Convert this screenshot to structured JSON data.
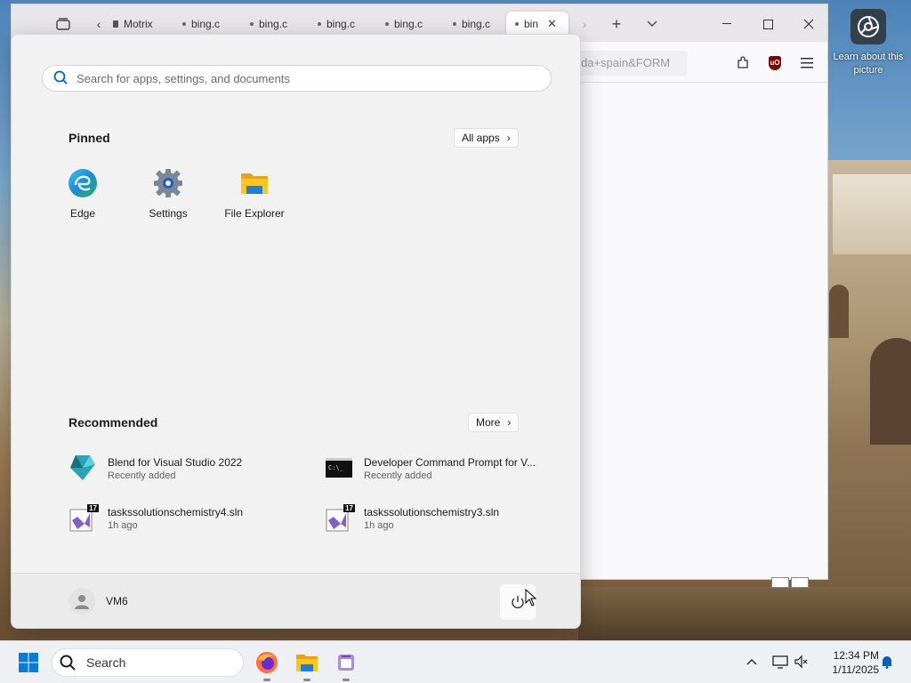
{
  "spotlight": {
    "label": "Learn about this picture"
  },
  "browser": {
    "tabs": [
      {
        "title": "Motrix"
      },
      {
        "title": "bing.c"
      },
      {
        "title": "bing.c"
      },
      {
        "title": "bing.c"
      },
      {
        "title": "bing.c"
      },
      {
        "title": "bing.c"
      },
      {
        "title": "bin"
      }
    ],
    "url_fragment": "da+spain&FORM"
  },
  "start_menu": {
    "search_placeholder": "Search for apps, settings, and documents",
    "pinned_title": "Pinned",
    "all_apps_label": "All apps",
    "pinned_apps": [
      {
        "label": "Edge",
        "icon": "edge-icon"
      },
      {
        "label": "Settings",
        "icon": "settings-gear-icon"
      },
      {
        "label": "File Explorer",
        "icon": "folder-icon"
      }
    ],
    "recommended_title": "Recommended",
    "more_label": "More",
    "recommended": [
      {
        "name": "Blend for Visual Studio 2022",
        "sub": "Recently added",
        "icon": "blend-icon"
      },
      {
        "name": "Developer Command Prompt for V...",
        "sub": "Recently added",
        "icon": "command-prompt-icon"
      },
      {
        "name": "taskssolutionschemistry4.sln",
        "sub": "1h ago",
        "icon": "visual-studio-solution-icon",
        "badge": "17"
      },
      {
        "name": "taskssolutionschemistry3.sln",
        "sub": "1h ago",
        "icon": "visual-studio-solution-icon",
        "badge": "17"
      }
    ],
    "user_name": "VM6"
  },
  "taskbar": {
    "search_label": "Search",
    "time": "12:34 PM",
    "date": "1/11/2025"
  }
}
